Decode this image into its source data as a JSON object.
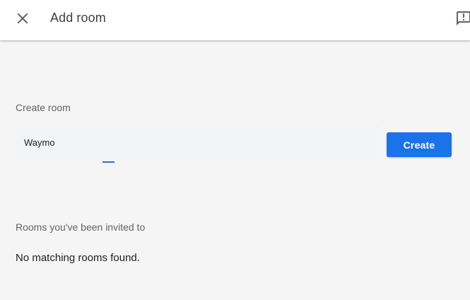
{
  "header": {
    "title": "Add room",
    "close_icon": "close-icon",
    "feedback_icon": "feedback-icon"
  },
  "create_section": {
    "label": "Create room",
    "input_value": "Waymo",
    "button_label": "Create"
  },
  "invited_section": {
    "label": "Rooms you've been invited to",
    "empty_message": "No matching rooms found."
  },
  "colors": {
    "accent": "#1a73e8",
    "background": "#f5f5f5",
    "header_background": "#ffffff",
    "input_background": "#f1f3f4"
  }
}
